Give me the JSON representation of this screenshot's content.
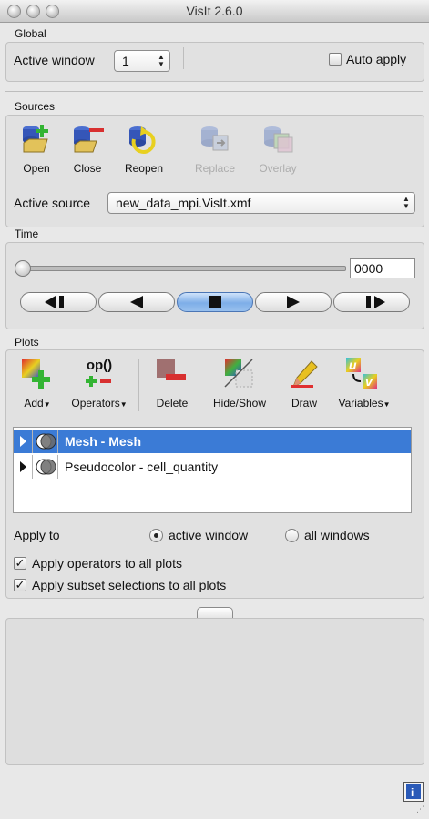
{
  "window": {
    "title": "VisIt 2.6.0"
  },
  "global": {
    "label": "Global",
    "active_window_label": "Active window",
    "active_window_value": "1",
    "auto_apply_label": "Auto apply",
    "auto_apply_checked": false
  },
  "sources": {
    "label": "Sources",
    "toolbar": [
      {
        "label": "Open",
        "icon": "open-icon",
        "enabled": true
      },
      {
        "label": "Close",
        "icon": "close-source-icon",
        "enabled": true
      },
      {
        "label": "Reopen",
        "icon": "reopen-icon",
        "enabled": true
      },
      {
        "label": "Replace",
        "icon": "replace-icon",
        "enabled": false
      },
      {
        "label": "Overlay",
        "icon": "overlay-icon",
        "enabled": false
      }
    ],
    "active_source_label": "Active source",
    "active_source_value": "new_data_mpi.VisIt.xmf"
  },
  "time": {
    "label": "Time",
    "slider_value": 0,
    "state_value": "0000",
    "vcr_buttons": [
      "step-back-icon",
      "play-reverse-icon",
      "stop-icon",
      "play-icon",
      "step-forward-icon"
    ]
  },
  "plots": {
    "label": "Plots",
    "toolbar": [
      {
        "label": "Add",
        "icon": "add-plot-icon",
        "menu": true
      },
      {
        "label": "Operators",
        "icon": "operators-icon",
        "menu": true
      },
      {
        "label": "Delete",
        "icon": "delete-icon",
        "menu": false
      },
      {
        "label": "Hide/Show",
        "icon": "hide-show-icon",
        "menu": false
      },
      {
        "label": "Draw",
        "icon": "draw-icon",
        "menu": false
      },
      {
        "label": "Variables",
        "icon": "variables-icon",
        "menu": true
      }
    ],
    "operators_icon_text": "op()",
    "items": [
      {
        "label": "Mesh - Mesh",
        "selected": true
      },
      {
        "label": "Pseudocolor - cell_quantity",
        "selected": false
      }
    ],
    "apply_to_label": "Apply to",
    "radio_active": "active window",
    "radio_all": "all windows",
    "apply_to_selected": "active window",
    "apply_operators_label": "Apply operators to all plots",
    "apply_operators_checked": true,
    "apply_subset_label": "Apply subset selections to all plots",
    "apply_subset_checked": true
  },
  "colors": {
    "selection": "#3b7bd6",
    "accent_green": "#33b433",
    "accent_red": "#d83030"
  }
}
